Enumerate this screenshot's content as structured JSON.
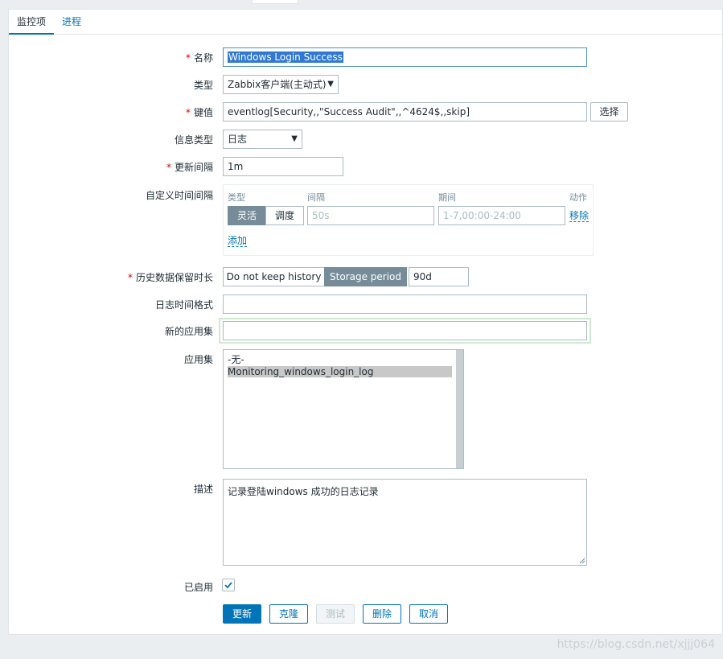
{
  "tabs": {
    "items": [
      "监控项",
      "进程"
    ]
  },
  "form": {
    "name": {
      "label": "名称",
      "value": "Windows Login Success"
    },
    "type": {
      "label": "类型",
      "value": "Zabbix客户端(主动式)"
    },
    "key": {
      "label": "键值",
      "value": "eventlog[Security,,\"Success Audit\",,^4624$,,skip]",
      "select_label": "选择"
    },
    "info_type": {
      "label": "信息类型",
      "value": "日志"
    },
    "update_interval": {
      "label": "更新间隔",
      "value": "1m"
    },
    "custom_intervals": {
      "label": "自定义时间间隔",
      "headers": {
        "type": "类型",
        "interval": "间隔",
        "period": "期间",
        "action": "动作"
      },
      "modes": [
        "灵活",
        "调度"
      ],
      "interval_placeholder": "50s",
      "period_placeholder": "1-7,00:00-24:00",
      "remove_label": "移除",
      "add_label": "添加"
    },
    "history": {
      "label": "历史数据保留时长",
      "options": [
        "Do not keep history",
        "Storage period"
      ],
      "value": "90d"
    },
    "log_time_format": {
      "label": "日志时间格式",
      "value": ""
    },
    "new_application": {
      "label": "新的应用集",
      "value": ""
    },
    "applications": {
      "label": "应用集",
      "items": [
        "-无-",
        "Monitoring_windows_login_log"
      ]
    },
    "description": {
      "label": "描述",
      "value": "记录登陆windows 成功的日志记录"
    },
    "enabled": {
      "label": "已启用",
      "checked": true
    }
  },
  "buttons": {
    "update": "更新",
    "clone": "克隆",
    "test": "测试",
    "delete": "删除",
    "cancel": "取消"
  },
  "watermark": "https://blog.csdn.net/xjjj064",
  "colors": {
    "accent": "#0275b8",
    "required": "#d40000",
    "segment_on": "#768d99",
    "focus_glow": "#cfe8d2"
  }
}
